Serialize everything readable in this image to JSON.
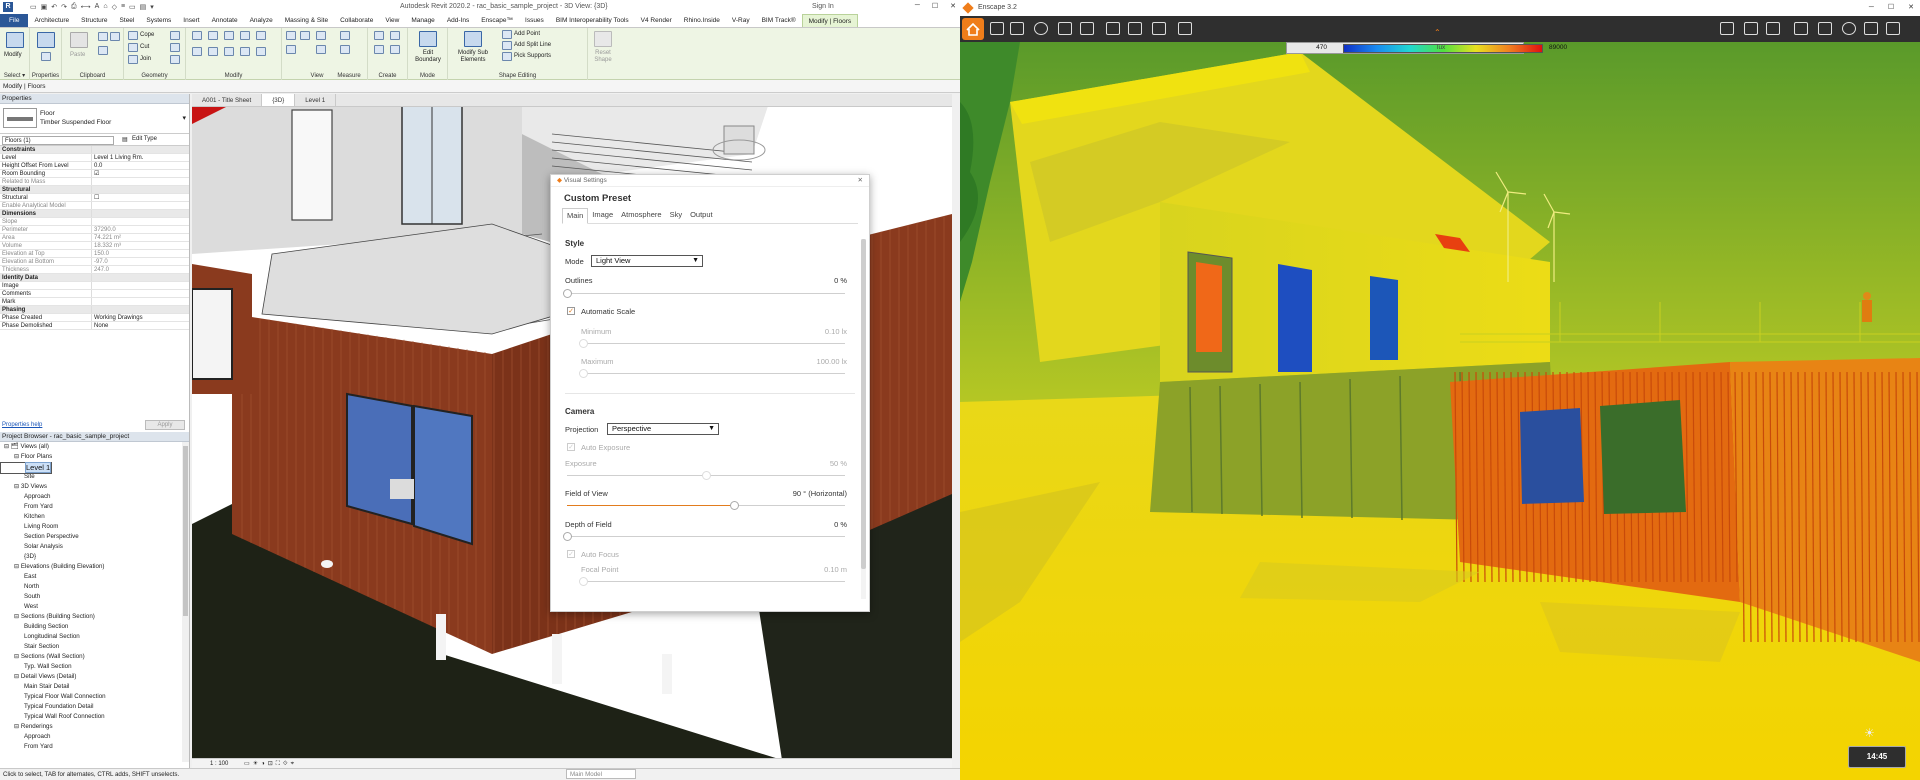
{
  "revit": {
    "window_title": "Autodesk Revit 2020.2 - rac_basic_sample_project - 3D View: {3D}",
    "sign_in": "Sign In",
    "tabs": [
      "File",
      "Architecture",
      "Structure",
      "Steel",
      "Systems",
      "Insert",
      "Annotate",
      "Analyze",
      "Massing & Site",
      "Collaborate",
      "View",
      "Manage",
      "Add-Ins",
      "Enscape™",
      "Issues",
      "BIM Interoperability Tools",
      "V4 Render",
      "Rhino.Inside",
      "V-Ray",
      "BIM Track®",
      "Modify | Floors"
    ],
    "active_tab": "Modify | Floors",
    "ribbon": {
      "modify_label": "Modify",
      "select_label": "Select ▾",
      "properties_label": "Properties",
      "clipboard_label": "Clipboard",
      "paste_label": "Paste",
      "cope_label": "Cope",
      "cut_label": "Cut",
      "join_label": "Join",
      "geometry_label": "Geometry",
      "modify_group_label": "Modify",
      "view_label": "View",
      "measure_label": "Measure",
      "create_label": "Create",
      "edit_boundary_label": "Edit Boundary",
      "mode_label": "Mode",
      "modify_sub_label": "Modify Sub Elements",
      "add_point_label": "Add Point",
      "add_split_line_label": "Add Split Line",
      "pick_supports_label": "Pick Supports",
      "shape_editing_label": "Shape Editing",
      "reset_shape_label": "Reset Shape"
    },
    "options_bar": "Modify | Floors",
    "properties": {
      "panel_title": "Properties",
      "family": "Floor",
      "type": "Timber Suspended Floor",
      "selector": "Floors (1)",
      "edit_type": "Edit Type",
      "rows": [
        {
          "k": "Constraints",
          "v": "",
          "sec": true
        },
        {
          "k": "Level",
          "v": "Level 1 Living Rm."
        },
        {
          "k": "Height Offset From Level",
          "v": "0.0"
        },
        {
          "k": "Room Bounding",
          "v": "☑"
        },
        {
          "k": "Related to Mass",
          "v": "",
          "g": true
        },
        {
          "k": "Structural",
          "v": "",
          "sec": true
        },
        {
          "k": "Structural",
          "v": "☐"
        },
        {
          "k": "Enable Analytical Model",
          "v": "",
          "g": true
        },
        {
          "k": "Dimensions",
          "v": "",
          "sec": true
        },
        {
          "k": "Slope",
          "v": "",
          "g": true
        },
        {
          "k": "Perimeter",
          "v": "37290.0",
          "g": true
        },
        {
          "k": "Area",
          "v": "74.221 m²",
          "g": true
        },
        {
          "k": "Volume",
          "v": "18.332 m³",
          "g": true
        },
        {
          "k": "Elevation at Top",
          "v": "150.0",
          "g": true
        },
        {
          "k": "Elevation at Bottom",
          "v": "-97.0",
          "g": true
        },
        {
          "k": "Thickness",
          "v": "247.0",
          "g": true
        },
        {
          "k": "Identity Data",
          "v": "",
          "sec": true
        },
        {
          "k": "Image",
          "v": ""
        },
        {
          "k": "Comments",
          "v": ""
        },
        {
          "k": "Mark",
          "v": ""
        },
        {
          "k": "Phasing",
          "v": "",
          "sec": true
        },
        {
          "k": "Phase Created",
          "v": "Working Drawings"
        },
        {
          "k": "Phase Demolished",
          "v": "None"
        }
      ],
      "help_link": "Properties help",
      "apply": "Apply"
    },
    "browser": {
      "title": "Project Browser - rac_basic_sample_project",
      "items": [
        {
          "t": "⊟ 🗂 Views (all)",
          "d": 0
        },
        {
          "t": "⊟ Floor Plans",
          "d": 1
        },
        {
          "t": "Level 1",
          "d": 2,
          "sel": true
        },
        {
          "t": "Level 2",
          "d": 2
        },
        {
          "t": "Site",
          "d": 2
        },
        {
          "t": "⊟ 3D Views",
          "d": 1
        },
        {
          "t": "Approach",
          "d": 2
        },
        {
          "t": "From Yard",
          "d": 2
        },
        {
          "t": "Kitchen",
          "d": 2
        },
        {
          "t": "Living Room",
          "d": 2
        },
        {
          "t": "Section Perspective",
          "d": 2
        },
        {
          "t": "Solar Analysis",
          "d": 2
        },
        {
          "t": "{3D}",
          "d": 2
        },
        {
          "t": "⊟ Elevations (Building Elevation)",
          "d": 1
        },
        {
          "t": "East",
          "d": 2
        },
        {
          "t": "North",
          "d": 2
        },
        {
          "t": "South",
          "d": 2
        },
        {
          "t": "West",
          "d": 2
        },
        {
          "t": "⊟ Sections (Building Section)",
          "d": 1
        },
        {
          "t": "Building Section",
          "d": 2
        },
        {
          "t": "Longitudinal Section",
          "d": 2
        },
        {
          "t": "Stair Section",
          "d": 2
        },
        {
          "t": "⊟ Sections (Wall Section)",
          "d": 1
        },
        {
          "t": "Typ. Wall Section",
          "d": 2
        },
        {
          "t": "⊟ Detail Views (Detail)",
          "d": 1
        },
        {
          "t": "Main Stair Detail",
          "d": 2
        },
        {
          "t": "Typical Floor Wall Connection",
          "d": 2
        },
        {
          "t": "Typical Foundation Detail",
          "d": 2
        },
        {
          "t": "Typical Wall Roof Connection",
          "d": 2
        },
        {
          "t": "⊟ Renderings",
          "d": 1
        },
        {
          "t": "Approach",
          "d": 2
        },
        {
          "t": "From Yard",
          "d": 2
        }
      ]
    },
    "view_tabs": [
      "A001 - Title Sheet",
      "{3D}",
      "Level 1"
    ],
    "active_view_tab": "{3D}",
    "view_scale": "1 : 100",
    "status": "Click to select, TAB for alternates, CTRL adds, SHIFT unselects.",
    "status_right": "Main Model"
  },
  "dialog": {
    "window_title": "Visual Settings",
    "preset_name": "Custom Preset",
    "tabs": [
      "Main",
      "Image",
      "Atmosphere",
      "Sky",
      "Output"
    ],
    "active_tab": "Main",
    "style_header": "Style",
    "mode_label": "Mode",
    "mode_value": "Light View",
    "outlines_label": "Outlines",
    "outlines_value": "0 %",
    "outlines_level": 0,
    "auto_scale_label": "Automatic Scale",
    "minimum_label": "Minimum",
    "minimum_value": "0.10 lx",
    "maximum_label": "Maximum",
    "maximum_value": "100.00 lx",
    "camera_header": "Camera",
    "projection_label": "Projection",
    "projection_value": "Perspective",
    "auto_exposure_label": "Auto Exposure",
    "exposure_label": "Exposure",
    "exposure_value": "50 %",
    "exposure_level": 0.5,
    "fov_label": "Field of View",
    "fov_value": "90 ° (Horizontal)",
    "fov_level": 0.6,
    "dof_label": "Depth of Field",
    "dof_value": "0 %",
    "dof_level": 0,
    "auto_focus_label": "Auto Focus",
    "focal_label": "Focal Point",
    "focal_value": "0.10 m"
  },
  "enscape": {
    "window_title": "Enscape 3.2",
    "legend_min": "470",
    "legend_mid": "lux",
    "legend_max": "89000",
    "time": "14:45",
    "accent": "#ef7d1a"
  }
}
